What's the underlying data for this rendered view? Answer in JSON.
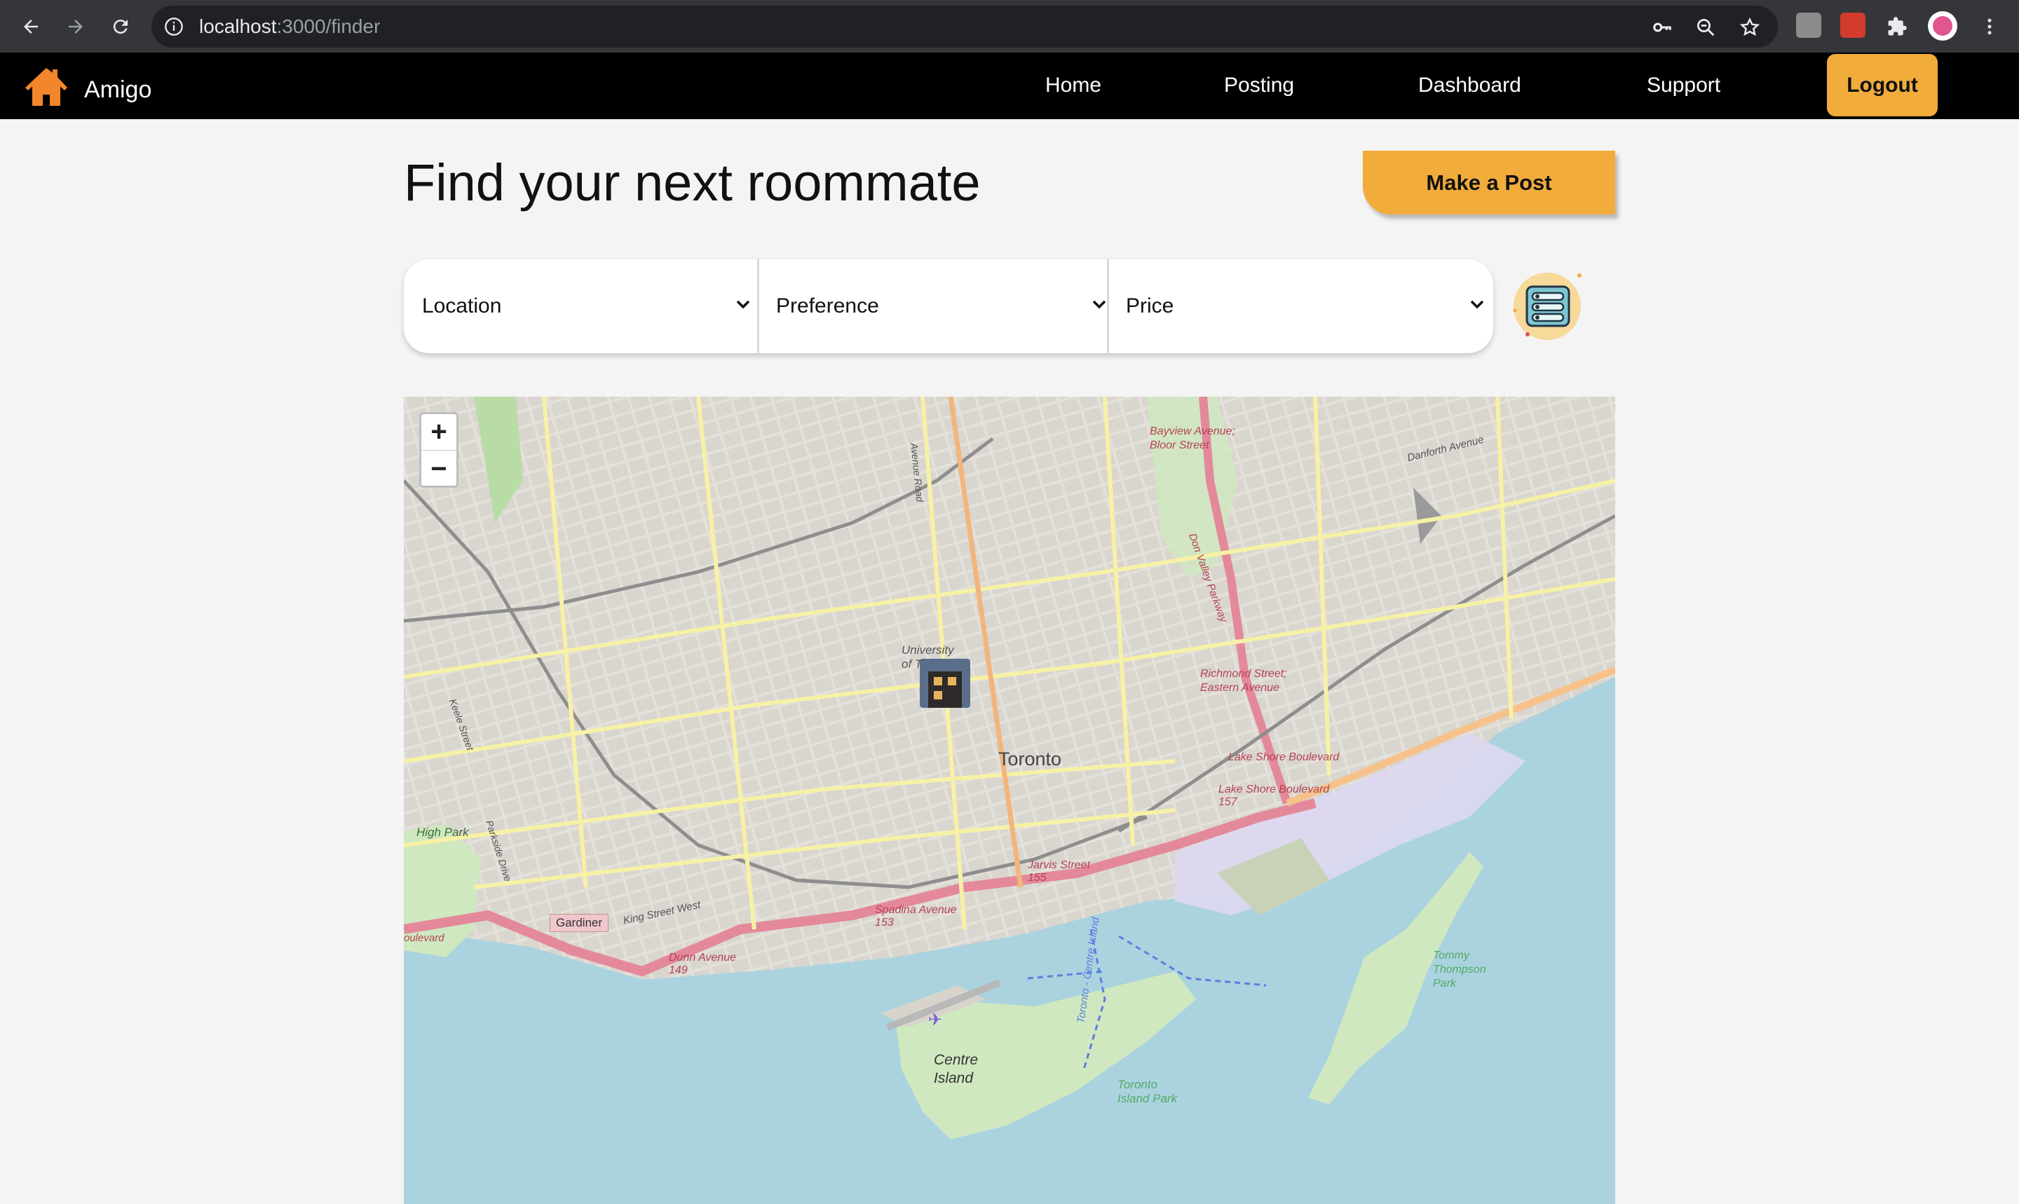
{
  "browser": {
    "url_host": "localhost",
    "url_path": ":3000/finder"
  },
  "nav": {
    "brand": "Amigo",
    "links": [
      "Home",
      "Posting",
      "Dashboard",
      "Support"
    ],
    "logout_label": "Logout"
  },
  "main": {
    "title": "Find your next roommate",
    "make_post_label": "Make a Post"
  },
  "filters": {
    "location": "Location",
    "preference": "Preference",
    "price": "Price"
  },
  "map": {
    "zoom_in": "+",
    "zoom_out": "−",
    "labels": {
      "city": "Toronto",
      "university": "University of T",
      "high_park": "High Park",
      "gardiner": "Gardiner",
      "centre_island": "Centre Island",
      "toronto_island_park": "Toronto Island Park",
      "tommy_thompson": "Tommy Thompson Park",
      "lake_shore_1": "Lake Shore Boulevard",
      "lake_shore_2": "Lake Shore Boulevard 157",
      "richmond": "Richmond Street; Eastern Avenue",
      "bayview": "Bayview Avenue; Bloor Street",
      "danforth": "Danforth Avenue",
      "spadina": "Spadina Avenue 153",
      "jarvis": "Jarvis Street 155",
      "dunn": "Dunn Avenue 149",
      "king_west": "King Street West",
      "keele": "Keele Street",
      "parkside": "Parkside Drive",
      "avenue_road": "Avenue Road",
      "don_valley": "Don Valley Parkway",
      "centre_island_ferry": "Toronto - Centre Island",
      "boulevard": "oulevard"
    }
  },
  "colors": {
    "accent": "#f2ac3c",
    "nav_bg": "#000000",
    "water": "#aad3df",
    "land": "#f2efe9"
  }
}
